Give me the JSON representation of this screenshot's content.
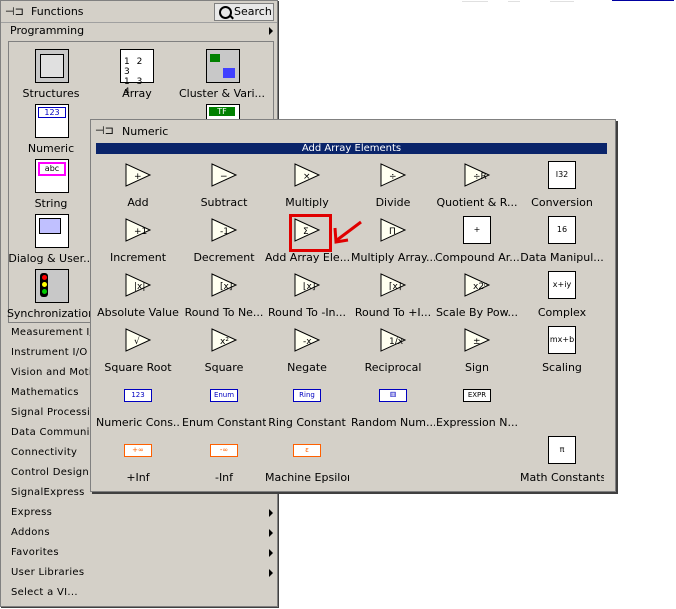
{
  "functions_palette": {
    "title": "Functions",
    "search_label": "Search",
    "category": "Programming",
    "icons": [
      {
        "label": "Structures"
      },
      {
        "label": "Array"
      },
      {
        "label": "Cluster & Vari..."
      },
      {
        "label": "Numeric"
      },
      {
        "label": "String"
      },
      {
        "label": "Dialog & User..."
      },
      {
        "label": "Synchronization"
      }
    ],
    "menu_items": [
      {
        "label": "Measurement I/O",
        "submenu": true
      },
      {
        "label": "Instrument I/O",
        "submenu": true
      },
      {
        "label": "Vision and Motion",
        "submenu": true
      },
      {
        "label": "Mathematics",
        "submenu": true
      },
      {
        "label": "Signal Processing",
        "submenu": true
      },
      {
        "label": "Data Communication",
        "submenu": true
      },
      {
        "label": "Connectivity",
        "submenu": true
      },
      {
        "label": "Control Design & Simulation",
        "submenu": true
      },
      {
        "label": "SignalExpress",
        "submenu": true
      },
      {
        "label": "Express",
        "submenu": true
      },
      {
        "label": "Addons",
        "submenu": true
      },
      {
        "label": "Favorites",
        "submenu": true
      },
      {
        "label": "User Libraries",
        "submenu": true
      },
      {
        "label": "Select a VI...",
        "submenu": false
      }
    ]
  },
  "numeric_palette": {
    "title": "Numeric",
    "selected_tooltip": "Add Array Elements",
    "items": [
      {
        "label": "Add",
        "glyph": "+"
      },
      {
        "label": "Subtract",
        "glyph": "−"
      },
      {
        "label": "Multiply",
        "glyph": "×"
      },
      {
        "label": "Divide",
        "glyph": "÷"
      },
      {
        "label": "Quotient & R...",
        "glyph": "÷R"
      },
      {
        "label": "Conversion",
        "glyph": "I32"
      },
      {
        "label": "Increment",
        "glyph": "+1"
      },
      {
        "label": "Decrement",
        "glyph": "-1"
      },
      {
        "label": "Add Array Ele...",
        "glyph": "Σ"
      },
      {
        "label": "Multiply Array...",
        "glyph": "Π"
      },
      {
        "label": "Compound Ar...",
        "glyph": "+"
      },
      {
        "label": "Data Manipul...",
        "glyph": "16"
      },
      {
        "label": "Absolute Value",
        "glyph": "|x|"
      },
      {
        "label": "Round To Ne...",
        "glyph": "[x]"
      },
      {
        "label": "Round To -In...",
        "glyph": "⌊x⌋"
      },
      {
        "label": "Round To +I...",
        "glyph": "⌈x⌉"
      },
      {
        "label": "Scale By Pow...",
        "glyph": "x2ⁿ"
      },
      {
        "label": "Complex",
        "glyph": "x+iy"
      },
      {
        "label": "Square Root",
        "glyph": "√"
      },
      {
        "label": "Square",
        "glyph": "x²"
      },
      {
        "label": "Negate",
        "glyph": "-x"
      },
      {
        "label": "Reciprocal",
        "glyph": "1/x"
      },
      {
        "label": "Sign",
        "glyph": "±"
      },
      {
        "label": "Scaling",
        "glyph": "mx+b"
      },
      {
        "label": "Numeric Cons...",
        "glyph": "123"
      },
      {
        "label": "Enum Constant",
        "glyph": "Enum"
      },
      {
        "label": "Ring Constant",
        "glyph": "Ring"
      },
      {
        "label": "Random Num...",
        "glyph": "⚅"
      },
      {
        "label": "Expression N...",
        "glyph": "EXPR"
      },
      {
        "label": "+Inf",
        "glyph": "+∞"
      },
      {
        "label": "-Inf",
        "glyph": "-∞"
      },
      {
        "label": "Machine Epsilon",
        "glyph": "ε"
      },
      {
        "label": "Math Constants",
        "glyph": "π"
      }
    ]
  },
  "colors": {
    "palette_bg": "#d4d0c8",
    "tooltip_bar": "#0a246a",
    "highlight": "#e00000"
  }
}
